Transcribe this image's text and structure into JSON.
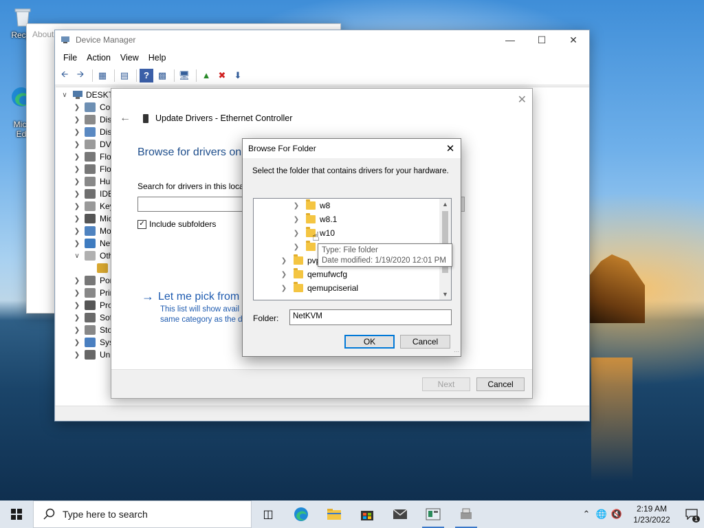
{
  "desktop": {
    "icons": [
      {
        "label": "Recyc"
      },
      {
        "label": "Micr\nEd"
      }
    ]
  },
  "about_window": {
    "title": "About"
  },
  "device_manager": {
    "title": "Device Manager",
    "menu": [
      "File",
      "Action",
      "View",
      "Help"
    ],
    "tree_root": "DESKTO",
    "tree_items": [
      {
        "label": "Cor",
        "expanded": false
      },
      {
        "label": "Disk",
        "expanded": false
      },
      {
        "label": "Disp",
        "expanded": false
      },
      {
        "label": "DVD",
        "expanded": false
      },
      {
        "label": "Flop",
        "expanded": false
      },
      {
        "label": "Flop",
        "expanded": false
      },
      {
        "label": "Hur",
        "expanded": false
      },
      {
        "label": "IDE",
        "expanded": false
      },
      {
        "label": "Key",
        "expanded": false
      },
      {
        "label": "Mic",
        "expanded": false
      },
      {
        "label": "Mo",
        "expanded": false
      },
      {
        "label": "Net",
        "expanded": false
      },
      {
        "label": "Oth",
        "expanded": true
      },
      {
        "label": "",
        "expanded": false
      },
      {
        "label": "Por",
        "expanded": false
      },
      {
        "label": "Prir",
        "expanded": false
      },
      {
        "label": "Pro",
        "expanded": false
      },
      {
        "label": "Soft",
        "expanded": false
      },
      {
        "label": "Stor",
        "expanded": false
      },
      {
        "label": "Syst",
        "expanded": false
      },
      {
        "label": "Uni",
        "expanded": false
      }
    ]
  },
  "wizard": {
    "title": "Update Drivers - Ethernet Controller",
    "heading": "Browse for drivers on",
    "search_label": "Search for drivers in this locat",
    "include_subfolders": "Include subfolders",
    "include_subfolders_checked": true,
    "pick_link": "Let me pick from",
    "pick_desc_line1": "This list will show avail",
    "pick_desc_line2": "same category as the d",
    "next_label": "Next",
    "cancel_label": "Cancel"
  },
  "browse_dialog": {
    "title": "Browse For Folder",
    "instruction": "Select the folder that contains drivers for your hardware.",
    "folders": [
      {
        "name": "w8",
        "level": 2
      },
      {
        "name": "w8.1",
        "level": 2
      },
      {
        "name": "w10",
        "level": 2
      },
      {
        "name": "",
        "level": 2
      },
      {
        "name": "pvp",
        "level": 1
      },
      {
        "name": "qemufwcfg",
        "level": 1
      },
      {
        "name": "qemupciserial",
        "level": 1
      }
    ],
    "folder_label": "Folder:",
    "folder_value": "NetKVM",
    "ok_label": "OK",
    "cancel_label": "Cancel"
  },
  "tooltip": {
    "type_line": "Type: File folder",
    "date_line": "Date modified: 1/19/2020 12:01 PM"
  },
  "taskbar": {
    "search_placeholder": "Type here to search",
    "time": "2:19 AM",
    "date": "1/23/2022",
    "notification_count": "1"
  }
}
